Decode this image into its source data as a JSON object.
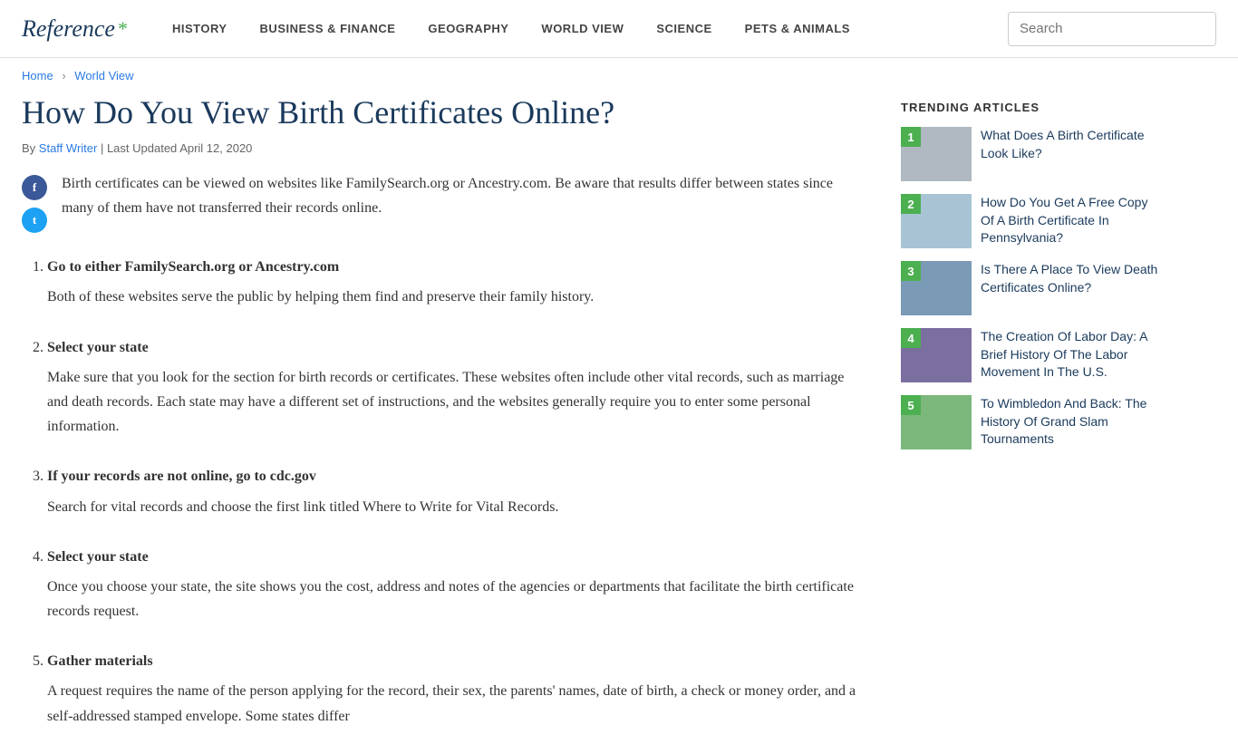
{
  "header": {
    "logo": "Reference",
    "logo_asterisk": "*",
    "nav": [
      {
        "label": "HISTORY",
        "id": "nav-history"
      },
      {
        "label": "BUSINESS & FINANCE",
        "id": "nav-business"
      },
      {
        "label": "GEOGRAPHY",
        "id": "nav-geography"
      },
      {
        "label": "WORLD VIEW",
        "id": "nav-worldview"
      },
      {
        "label": "SCIENCE",
        "id": "nav-science"
      },
      {
        "label": "PETS & ANIMALS",
        "id": "nav-pets"
      }
    ],
    "search_placeholder": "Search"
  },
  "breadcrumb": {
    "home": "Home",
    "section": "World View"
  },
  "article": {
    "title": "How Do You View Birth Certificates Online?",
    "meta_by": "By ",
    "meta_author": "Staff Writer",
    "meta_sep": " | Last Updated ",
    "meta_date": "April 12, 2020",
    "intro": "Birth certificates can be viewed on websites like FamilySearch.org or Ancestry.com. Be aware that results differ between states since many of them have not transferred their records online.",
    "steps": [
      {
        "num": 1,
        "title": "Go to either FamilySearch.org or Ancestry.com",
        "body": "Both of these websites serve the public by helping them find and preserve their family history."
      },
      {
        "num": 2,
        "title": "Select your state",
        "body": "Make sure that you look for the section for birth records or certificates. These websites often include other vital records, such as marriage and death records. Each state may have a different set of instructions, and the websites generally require you to enter some personal information."
      },
      {
        "num": 3,
        "title": "If your records are not online, go to cdc.gov",
        "body": "Search for vital records and choose the first link titled Where to Write for Vital Records."
      },
      {
        "num": 4,
        "title": "Select your state",
        "body": "Once you choose your state, the site shows you the cost, address and notes of the agencies or departments that facilitate the birth certificate records request."
      },
      {
        "num": 5,
        "title": "Gather materials",
        "body": "A request requires the name of the person applying for the record, their sex, the parents' names, date of birth, a check or money order, and a self-addressed stamped envelope. Some states differ"
      }
    ]
  },
  "sidebar": {
    "trending_title": "TRENDING ARTICLES",
    "items": [
      {
        "num": "1",
        "title": "What Does A Birth Certificate Look Like?",
        "img_class": "img-1"
      },
      {
        "num": "2",
        "title": "How Do You Get A Free Copy Of A Birth Certificate In Pennsylvania?",
        "img_class": "img-2"
      },
      {
        "num": "3",
        "title": "Is There A Place To View Death Certificates Online?",
        "img_class": "img-3"
      },
      {
        "num": "4",
        "title": "The Creation Of Labor Day: A Brief History Of The Labor Movement In The U.S.",
        "img_class": "img-4"
      },
      {
        "num": "5",
        "title": "To Wimbledon And Back: The History Of Grand Slam Tournaments",
        "img_class": "img-5"
      }
    ]
  }
}
